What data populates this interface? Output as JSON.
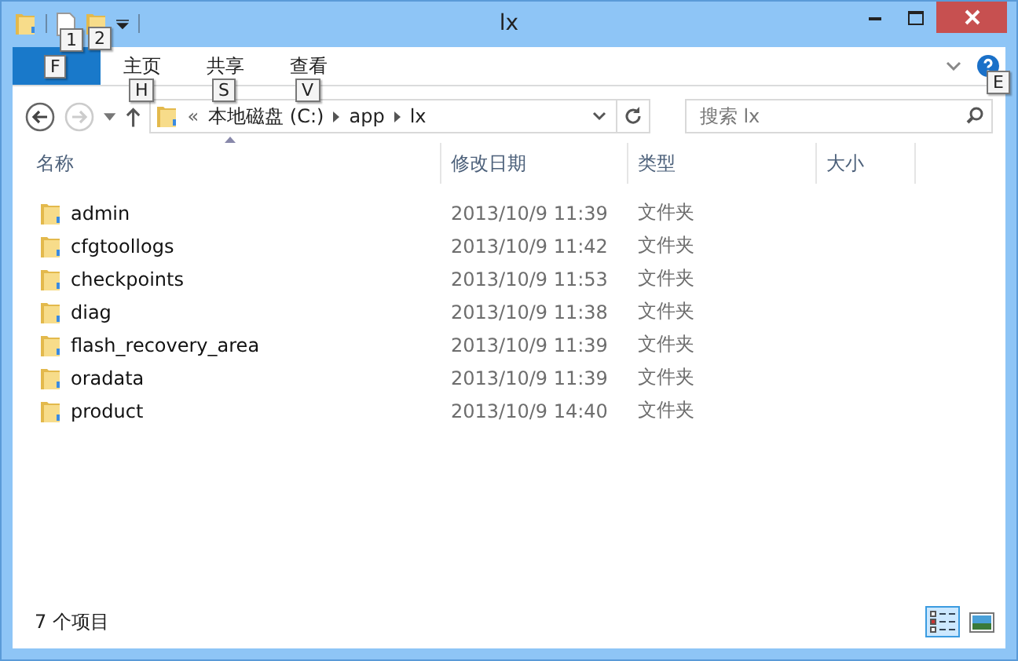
{
  "window": {
    "title": "lx"
  },
  "quick_access": [
    {
      "kind": "properties",
      "keytip": "1"
    },
    {
      "kind": "new-folder",
      "keytip": "2"
    }
  ],
  "ribbon_tabs": [
    {
      "kind": "file",
      "keytip": "F"
    },
    {
      "kind": "tab",
      "label": "主页",
      "keytip": "H"
    },
    {
      "kind": "tab",
      "label": "共享",
      "keytip": "S"
    },
    {
      "kind": "tab",
      "label": "查看",
      "keytip": "V"
    }
  ],
  "help": {
    "keytip": "E"
  },
  "address": {
    "overflow": "«",
    "segments": [
      "本地磁盘 (C:)",
      "app",
      "lx"
    ]
  },
  "search": {
    "placeholder": "搜索 lx"
  },
  "columns": [
    {
      "label": "名称",
      "sorted": true
    },
    {
      "label": "修改日期",
      "sorted": false
    },
    {
      "label": "类型",
      "sorted": false
    },
    {
      "label": "大小",
      "sorted": false
    }
  ],
  "rows": [
    {
      "name": "admin",
      "modified": "2013/10/9 11:39",
      "type": "文件夹"
    },
    {
      "name": "cfgtoollogs",
      "modified": "2013/10/9 11:42",
      "type": "文件夹"
    },
    {
      "name": "checkpoints",
      "modified": "2013/10/9 11:53",
      "type": "文件夹"
    },
    {
      "name": "diag",
      "modified": "2013/10/9 11:38",
      "type": "文件夹"
    },
    {
      "name": "flash_recovery_area",
      "modified": "2013/10/9 11:39",
      "type": "文件夹"
    },
    {
      "name": "oradata",
      "modified": "2013/10/9 11:39",
      "type": "文件夹"
    },
    {
      "name": "product",
      "modified": "2013/10/9 14:40",
      "type": "文件夹"
    }
  ],
  "status_bar": {
    "item_count": "7 个项目"
  },
  "view_buttons": [
    {
      "kind": "details",
      "selected": true
    },
    {
      "kind": "large-icons",
      "selected": false
    }
  ]
}
